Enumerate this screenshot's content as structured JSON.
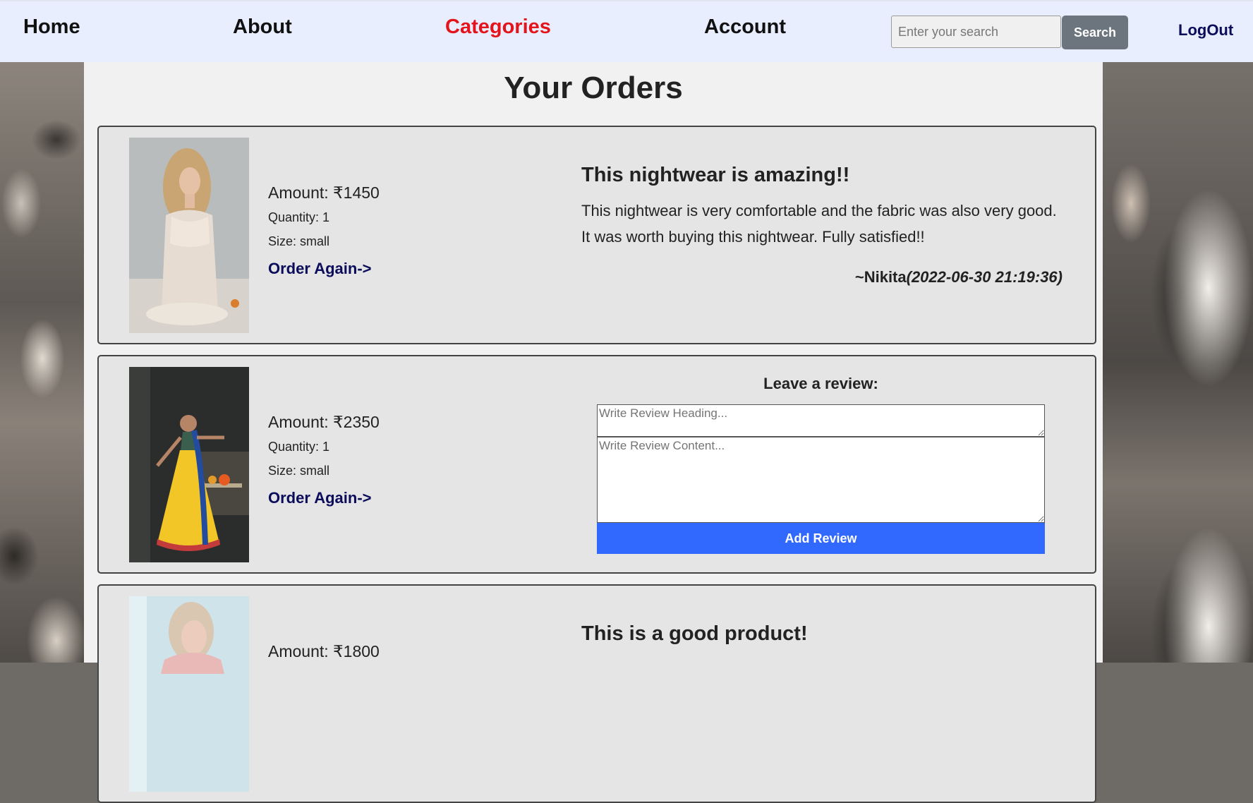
{
  "nav": {
    "home": "Home",
    "about": "About",
    "categories": "Categories",
    "account": "Account",
    "search_placeholder": "Enter your search",
    "search_button": "Search",
    "logout": "LogOut",
    "active_color": "#e3141b"
  },
  "page": {
    "title": "Your Orders"
  },
  "orders": [
    {
      "amount": "Amount: ₹1450",
      "quantity": "Quantity: 1",
      "size": "Size: small",
      "order_again": "Order Again->",
      "review": {
        "heading": "This nightwear is amazing!!",
        "content": "This nightwear is very comfortable and the fabric was also very good. It was worth buying this nightwear. Fully satisfied!!",
        "author": "~Nikita",
        "date": "(2022-06-30 21:19:36)"
      }
    },
    {
      "amount": "Amount: ₹2350",
      "quantity": "Quantity: 1",
      "size": "Size: small",
      "order_again": "Order Again->",
      "review_form": {
        "title": "Leave a review:",
        "heading_placeholder": "Write Review Heading...",
        "content_placeholder": "Write Review Content...",
        "submit": "Add Review"
      }
    },
    {
      "amount": "Amount: ₹1800",
      "review": {
        "heading": "This is a good product!"
      }
    }
  ],
  "colors": {
    "nav_bg": "#e8eefe",
    "link_dark": "#0b0d5a",
    "add_review_bg": "#3168fd",
    "search_button_bg": "#6c757d"
  }
}
